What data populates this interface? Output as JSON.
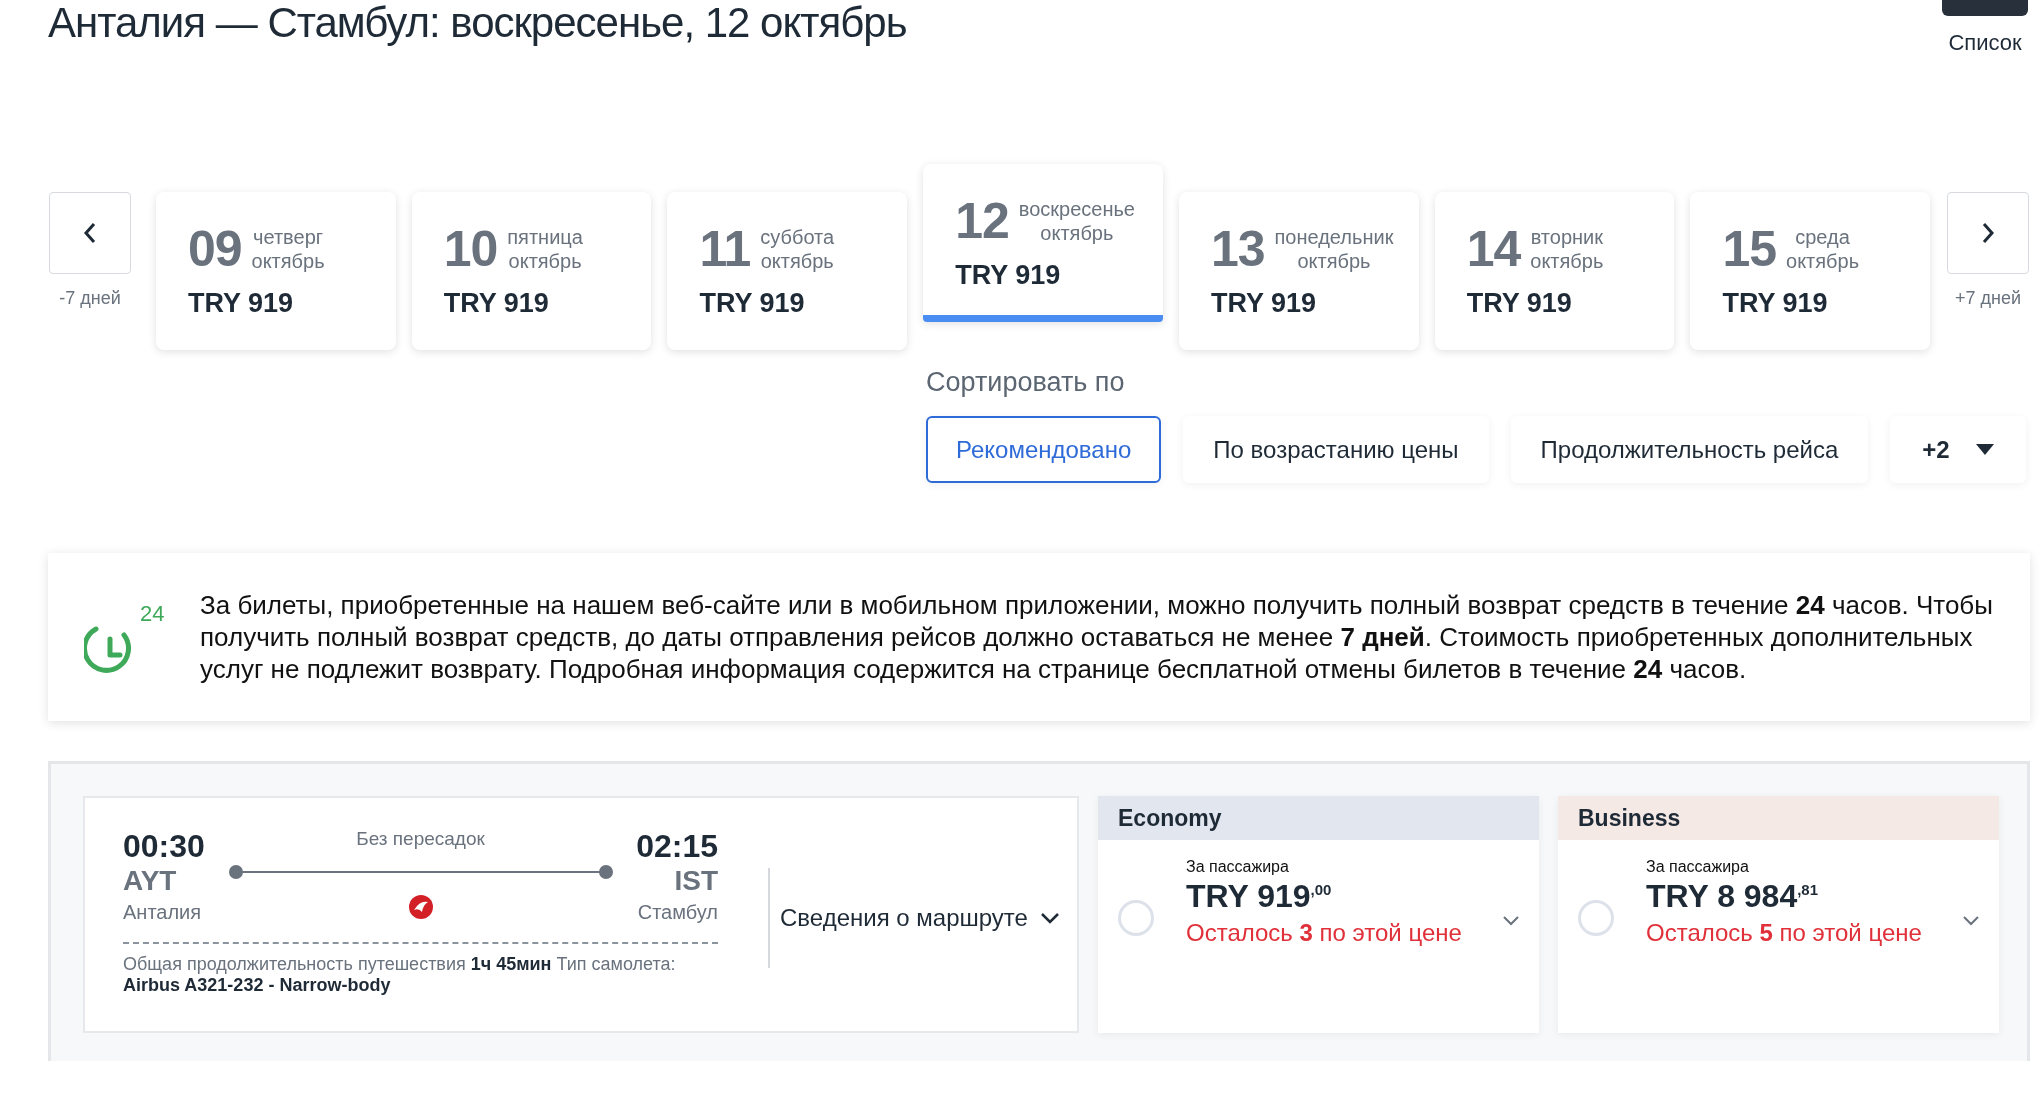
{
  "title": "Анталия — Стамбул: воскресенье, 12 октябрь",
  "list_button": {
    "label": "Список"
  },
  "date_nav": {
    "prev": {
      "label": "-7 дней"
    },
    "next": {
      "label": "+7 дней"
    },
    "dates": [
      {
        "day": "09",
        "weekday": "четверг",
        "month": "октябрь",
        "price": "TRY 919",
        "selected": false
      },
      {
        "day": "10",
        "weekday": "пятница",
        "month": "октябрь",
        "price": "TRY 919",
        "selected": false
      },
      {
        "day": "11",
        "weekday": "суббота",
        "month": "октябрь",
        "price": "TRY 919",
        "selected": false
      },
      {
        "day": "12",
        "weekday": "воскресенье",
        "month": "октябрь",
        "price": "TRY 919",
        "selected": true
      },
      {
        "day": "13",
        "weekday": "понедельник",
        "month": "октябрь",
        "price": "TRY 919",
        "selected": false
      },
      {
        "day": "14",
        "weekday": "вторник",
        "month": "октябрь",
        "price": "TRY 919",
        "selected": false
      },
      {
        "day": "15",
        "weekday": "среда",
        "month": "октябрь",
        "price": "TRY 919",
        "selected": false
      }
    ]
  },
  "sort": {
    "label": "Сортировать по",
    "options": [
      {
        "label": "Рекомендовано",
        "kind": "option",
        "selected": true
      },
      {
        "label": "По возрастанию цены",
        "kind": "option",
        "selected": false
      },
      {
        "label": "Продолжительность рейса",
        "kind": "option",
        "selected": false
      },
      {
        "label": "+2",
        "kind": "dropdown",
        "selected": false
      }
    ]
  },
  "notice": {
    "text": "За билеты, приобретенные на нашем веб-сайте или в мобильном приложении, можно получить полный возврат средств в течение **24** часов. Чтобы получить полный возврат средств, до даты отправления рейсов должно оставаться не менее **7 дней**. Стоимость приобретенных дополнительных услуг не подлежит возврату. Подробная информация содержится на странице бесплатной отмены билетов в течение **24** часов.",
    "icon_label": "24"
  },
  "flight": {
    "stops": "Без пересадок",
    "departure": {
      "time": "00:30",
      "code": "AYT",
      "city": "Анталия"
    },
    "arrival": {
      "time": "02:15",
      "code": "IST",
      "city": "Стамбул"
    },
    "summary": "Общая продолжительность путешествия **1ч 45мин** Тип самолета: **Airbus A321-232 - Narrow-body**",
    "details_button": "Сведения о маршруте",
    "fares": [
      {
        "cabin": "Economy",
        "color": "#e1e6ef",
        "per_passenger": "За пассажира",
        "price": "TRY 919",
        "cents": ",00",
        "seats_left": "Осталось **3** по этой цене",
        "selected": false
      },
      {
        "cabin": "Business",
        "color": "#f5e9e6",
        "per_passenger": "За пассажира",
        "price": "TRY 8 984",
        "cents": ",81",
        "seats_left": "Осталось **5** по этой цене",
        "selected": false
      }
    ]
  }
}
